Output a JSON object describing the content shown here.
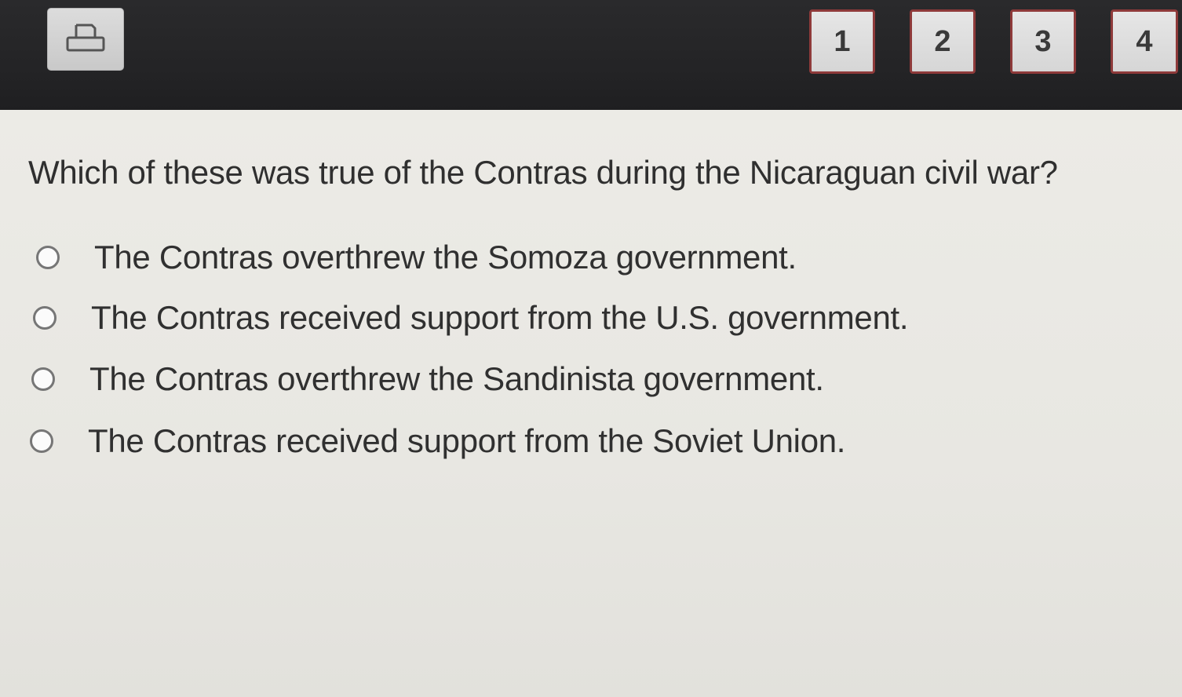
{
  "header": {
    "print_icon": "printer-icon",
    "question_numbers": [
      "1",
      "2",
      "3",
      "4"
    ]
  },
  "question": {
    "text": "Which of these was true of the Contras during the Nicaraguan civil war?"
  },
  "options": [
    "The Contras overthrew the Somoza government.",
    "The Contras received support from the U.S. government.",
    "The Contras overthrew the Sandinista government.",
    "The Contras received support from the Soviet Union."
  ],
  "colors": {
    "topbar": "#232325",
    "question_border": "#8e3a3a",
    "background": "#e9e8e4",
    "text": "#2f2f2f"
  }
}
